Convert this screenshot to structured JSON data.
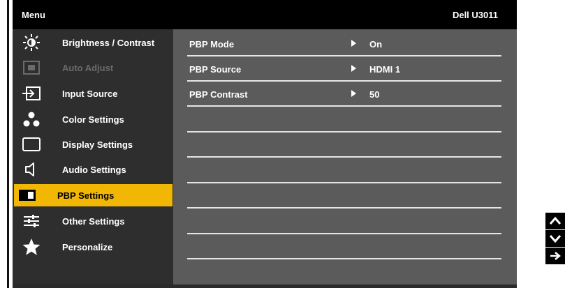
{
  "header": {
    "menu_title": "Menu",
    "model": "Dell U3011"
  },
  "sidebar": {
    "items": [
      {
        "label": "Brightness / Contrast",
        "icon": "brightness-icon",
        "state": "normal"
      },
      {
        "label": "Auto Adjust",
        "icon": "auto-adjust-icon",
        "state": "disabled"
      },
      {
        "label": "Input Source",
        "icon": "input-source-icon",
        "state": "normal"
      },
      {
        "label": "Color Settings",
        "icon": "color-settings-icon",
        "state": "normal"
      },
      {
        "label": "Display Settings",
        "icon": "display-settings-icon",
        "state": "normal"
      },
      {
        "label": "Audio Settings",
        "icon": "audio-icon",
        "state": "normal"
      },
      {
        "label": "PBP Settings",
        "icon": "pbp-icon",
        "state": "selected"
      },
      {
        "label": "Other Settings",
        "icon": "other-settings-icon",
        "state": "normal"
      },
      {
        "label": "Personalize",
        "icon": "star-icon",
        "state": "normal"
      }
    ]
  },
  "content": {
    "rows": [
      {
        "label": "PBP Mode",
        "value": "On"
      },
      {
        "label": "PBP Source",
        "value": "HDMI 1"
      },
      {
        "label": "PBP Contrast",
        "value": "50"
      },
      {
        "label": "",
        "value": ""
      },
      {
        "label": "",
        "value": ""
      },
      {
        "label": "",
        "value": ""
      },
      {
        "label": "",
        "value": ""
      },
      {
        "label": "",
        "value": ""
      },
      {
        "label": "",
        "value": ""
      }
    ]
  },
  "nav_buttons": [
    "up-arrow-icon",
    "down-arrow-icon",
    "enter-arrow-icon"
  ],
  "colors": {
    "selected": "#f2b705",
    "sidebar_bg": "#2e2e2e",
    "content_bg": "#5b5b5b",
    "disabled_text": "#6b6b6b"
  }
}
